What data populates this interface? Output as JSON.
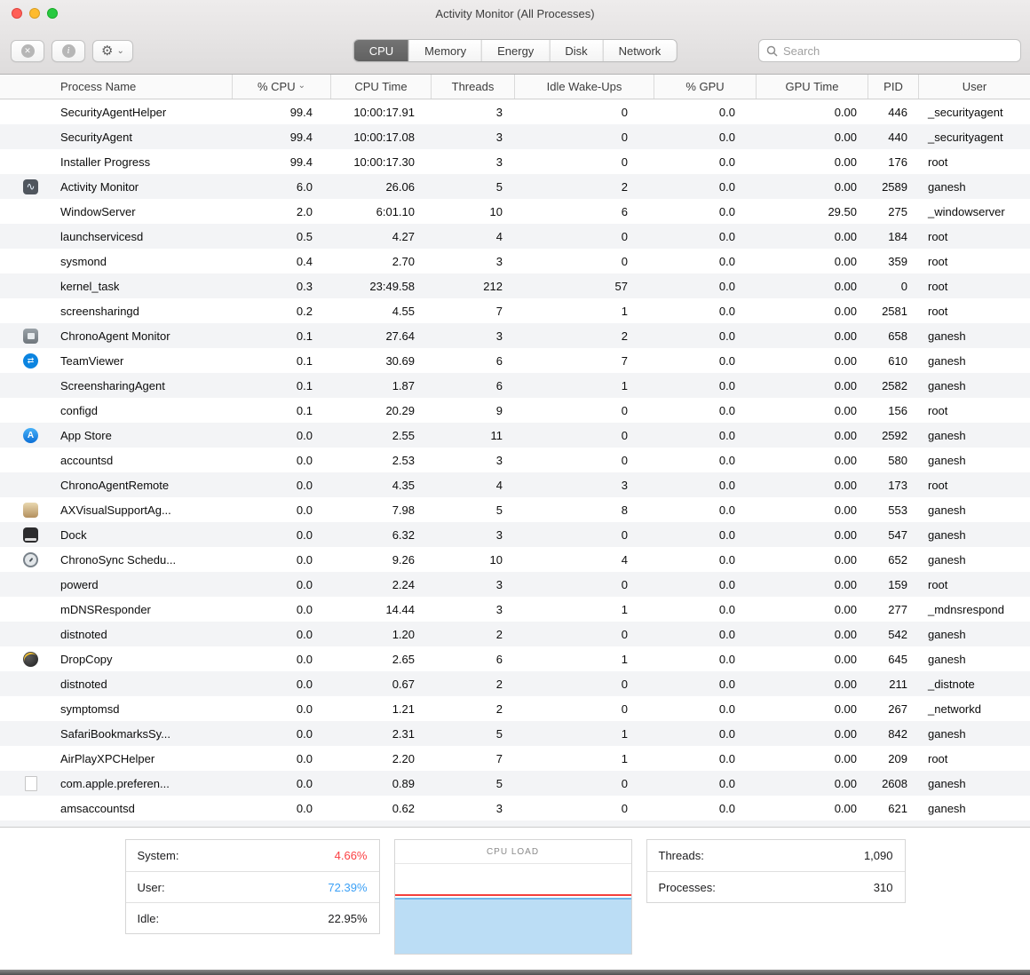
{
  "window": {
    "title": "Activity Monitor (All Processes)"
  },
  "toolbar": {
    "segments": [
      "CPU",
      "Memory",
      "Energy",
      "Disk",
      "Network"
    ],
    "selected_segment": "CPU",
    "search_placeholder": "Search"
  },
  "table": {
    "columns": [
      "Process Name",
      "% CPU",
      "CPU Time",
      "Threads",
      "Idle Wake-Ups",
      "% GPU",
      "GPU Time",
      "PID",
      "User"
    ],
    "sort_column": "% CPU",
    "sort_direction": "descending",
    "rows": [
      {
        "icon": "",
        "name": "SecurityAgentHelper",
        "cpu": "99.4",
        "cpu_time": "10:00:17.91",
        "threads": "3",
        "idle_wakeups": "0",
        "gpu": "0.0",
        "gpu_time": "0.00",
        "pid": "446",
        "user": "_securityagent"
      },
      {
        "icon": "",
        "name": "SecurityAgent",
        "cpu": "99.4",
        "cpu_time": "10:00:17.08",
        "threads": "3",
        "idle_wakeups": "0",
        "gpu": "0.0",
        "gpu_time": "0.00",
        "pid": "440",
        "user": "_securityagent"
      },
      {
        "icon": "",
        "name": "Installer Progress",
        "cpu": "99.4",
        "cpu_time": "10:00:17.30",
        "threads": "3",
        "idle_wakeups": "0",
        "gpu": "0.0",
        "gpu_time": "0.00",
        "pid": "176",
        "user": "root"
      },
      {
        "icon": "activity-monitor",
        "name": "Activity Monitor",
        "cpu": "6.0",
        "cpu_time": "26.06",
        "threads": "5",
        "idle_wakeups": "2",
        "gpu": "0.0",
        "gpu_time": "0.00",
        "pid": "2589",
        "user": "ganesh"
      },
      {
        "icon": "",
        "name": "WindowServer",
        "cpu": "2.0",
        "cpu_time": "6:01.10",
        "threads": "10",
        "idle_wakeups": "6",
        "gpu": "0.0",
        "gpu_time": "29.50",
        "pid": "275",
        "user": "_windowserver"
      },
      {
        "icon": "",
        "name": "launchservicesd",
        "cpu": "0.5",
        "cpu_time": "4.27",
        "threads": "4",
        "idle_wakeups": "0",
        "gpu": "0.0",
        "gpu_time": "0.00",
        "pid": "184",
        "user": "root"
      },
      {
        "icon": "",
        "name": "sysmond",
        "cpu": "0.4",
        "cpu_time": "2.70",
        "threads": "3",
        "idle_wakeups": "0",
        "gpu": "0.0",
        "gpu_time": "0.00",
        "pid": "359",
        "user": "root"
      },
      {
        "icon": "",
        "name": "kernel_task",
        "cpu": "0.3",
        "cpu_time": "23:49.58",
        "threads": "212",
        "idle_wakeups": "57",
        "gpu": "0.0",
        "gpu_time": "0.00",
        "pid": "0",
        "user": "root"
      },
      {
        "icon": "",
        "name": "screensharingd",
        "cpu": "0.2",
        "cpu_time": "4.55",
        "threads": "7",
        "idle_wakeups": "1",
        "gpu": "0.0",
        "gpu_time": "0.00",
        "pid": "2581",
        "user": "root"
      },
      {
        "icon": "chrono-agent",
        "name": "ChronoAgent Monitor",
        "cpu": "0.1",
        "cpu_time": "27.64",
        "threads": "3",
        "idle_wakeups": "2",
        "gpu": "0.0",
        "gpu_time": "0.00",
        "pid": "658",
        "user": "ganesh"
      },
      {
        "icon": "teamviewer",
        "name": "TeamViewer",
        "cpu": "0.1",
        "cpu_time": "30.69",
        "threads": "6",
        "idle_wakeups": "7",
        "gpu": "0.0",
        "gpu_time": "0.00",
        "pid": "610",
        "user": "ganesh"
      },
      {
        "icon": "",
        "name": "ScreensharingAgent",
        "cpu": "0.1",
        "cpu_time": "1.87",
        "threads": "6",
        "idle_wakeups": "1",
        "gpu": "0.0",
        "gpu_time": "0.00",
        "pid": "2582",
        "user": "ganesh"
      },
      {
        "icon": "",
        "name": "configd",
        "cpu": "0.1",
        "cpu_time": "20.29",
        "threads": "9",
        "idle_wakeups": "0",
        "gpu": "0.0",
        "gpu_time": "0.00",
        "pid": "156",
        "user": "root"
      },
      {
        "icon": "app-store",
        "name": "App Store",
        "cpu": "0.0",
        "cpu_time": "2.55",
        "threads": "11",
        "idle_wakeups": "0",
        "gpu": "0.0",
        "gpu_time": "0.00",
        "pid": "2592",
        "user": "ganesh"
      },
      {
        "icon": "",
        "name": "accountsd",
        "cpu": "0.0",
        "cpu_time": "2.53",
        "threads": "3",
        "idle_wakeups": "0",
        "gpu": "0.0",
        "gpu_time": "0.00",
        "pid": "580",
        "user": "ganesh"
      },
      {
        "icon": "",
        "name": "ChronoAgentRemote",
        "cpu": "0.0",
        "cpu_time": "4.35",
        "threads": "4",
        "idle_wakeups": "3",
        "gpu": "0.0",
        "gpu_time": "0.00",
        "pid": "173",
        "user": "root"
      },
      {
        "icon": "ax-visual",
        "name": "AXVisualSupportAg...",
        "cpu": "0.0",
        "cpu_time": "7.98",
        "threads": "5",
        "idle_wakeups": "8",
        "gpu": "0.0",
        "gpu_time": "0.00",
        "pid": "553",
        "user": "ganesh"
      },
      {
        "icon": "dock",
        "name": "Dock",
        "cpu": "0.0",
        "cpu_time": "6.32",
        "threads": "3",
        "idle_wakeups": "0",
        "gpu": "0.0",
        "gpu_time": "0.00",
        "pid": "547",
        "user": "ganesh"
      },
      {
        "icon": "chronosync",
        "name": "ChronoSync Schedu...",
        "cpu": "0.0",
        "cpu_time": "9.26",
        "threads": "10",
        "idle_wakeups": "4",
        "gpu": "0.0",
        "gpu_time": "0.00",
        "pid": "652",
        "user": "ganesh"
      },
      {
        "icon": "",
        "name": "powerd",
        "cpu": "0.0",
        "cpu_time": "2.24",
        "threads": "3",
        "idle_wakeups": "0",
        "gpu": "0.0",
        "gpu_time": "0.00",
        "pid": "159",
        "user": "root"
      },
      {
        "icon": "",
        "name": "mDNSResponder",
        "cpu": "0.0",
        "cpu_time": "14.44",
        "threads": "3",
        "idle_wakeups": "1",
        "gpu": "0.0",
        "gpu_time": "0.00",
        "pid": "277",
        "user": "_mdnsrespond"
      },
      {
        "icon": "",
        "name": "distnoted",
        "cpu": "0.0",
        "cpu_time": "1.20",
        "threads": "2",
        "idle_wakeups": "0",
        "gpu": "0.0",
        "gpu_time": "0.00",
        "pid": "542",
        "user": "ganesh"
      },
      {
        "icon": "dropcopy",
        "name": "DropCopy",
        "cpu": "0.0",
        "cpu_time": "2.65",
        "threads": "6",
        "idle_wakeups": "1",
        "gpu": "0.0",
        "gpu_time": "0.00",
        "pid": "645",
        "user": "ganesh"
      },
      {
        "icon": "",
        "name": "distnoted",
        "cpu": "0.0",
        "cpu_time": "0.67",
        "threads": "2",
        "idle_wakeups": "0",
        "gpu": "0.0",
        "gpu_time": "0.00",
        "pid": "211",
        "user": "_distnote"
      },
      {
        "icon": "",
        "name": "symptomsd",
        "cpu": "0.0",
        "cpu_time": "1.21",
        "threads": "2",
        "idle_wakeups": "0",
        "gpu": "0.0",
        "gpu_time": "0.00",
        "pid": "267",
        "user": "_networkd"
      },
      {
        "icon": "",
        "name": "SafariBookmarksSy...",
        "cpu": "0.0",
        "cpu_time": "2.31",
        "threads": "5",
        "idle_wakeups": "1",
        "gpu": "0.0",
        "gpu_time": "0.00",
        "pid": "842",
        "user": "ganesh"
      },
      {
        "icon": "",
        "name": "AirPlayXPCHelper",
        "cpu": "0.0",
        "cpu_time": "2.20",
        "threads": "7",
        "idle_wakeups": "1",
        "gpu": "0.0",
        "gpu_time": "0.00",
        "pid": "209",
        "user": "root"
      },
      {
        "icon": "document",
        "name": "com.apple.preferen...",
        "cpu": "0.0",
        "cpu_time": "0.89",
        "threads": "5",
        "idle_wakeups": "0",
        "gpu": "0.0",
        "gpu_time": "0.00",
        "pid": "2608",
        "user": "ganesh"
      },
      {
        "icon": "",
        "name": "amsaccountsd",
        "cpu": "0.0",
        "cpu_time": "0.62",
        "threads": "3",
        "idle_wakeups": "0",
        "gpu": "0.0",
        "gpu_time": "0.00",
        "pid": "621",
        "user": "ganesh"
      },
      {
        "icon": "",
        "name": "",
        "cpu": "",
        "cpu_time": "",
        "threads": "",
        "idle_wakeups": "",
        "gpu": "",
        "gpu_time": "",
        "pid": "",
        "user": ""
      }
    ]
  },
  "footer": {
    "system_label": "System:",
    "system_value": "4.66%",
    "user_label": "User:",
    "user_value": "72.39%",
    "idle_label": "Idle:",
    "idle_value": "22.95%",
    "cpu_load_label": "CPU LOAD",
    "threads_label": "Threads:",
    "threads_value": "1,090",
    "processes_label": "Processes:",
    "processes_value": "310"
  },
  "colors": {
    "system_red": "#fb4043",
    "user_blue": "#3ba0f6",
    "graph_fill": "#bbddf5",
    "selected_segment_bg": "#666666"
  }
}
